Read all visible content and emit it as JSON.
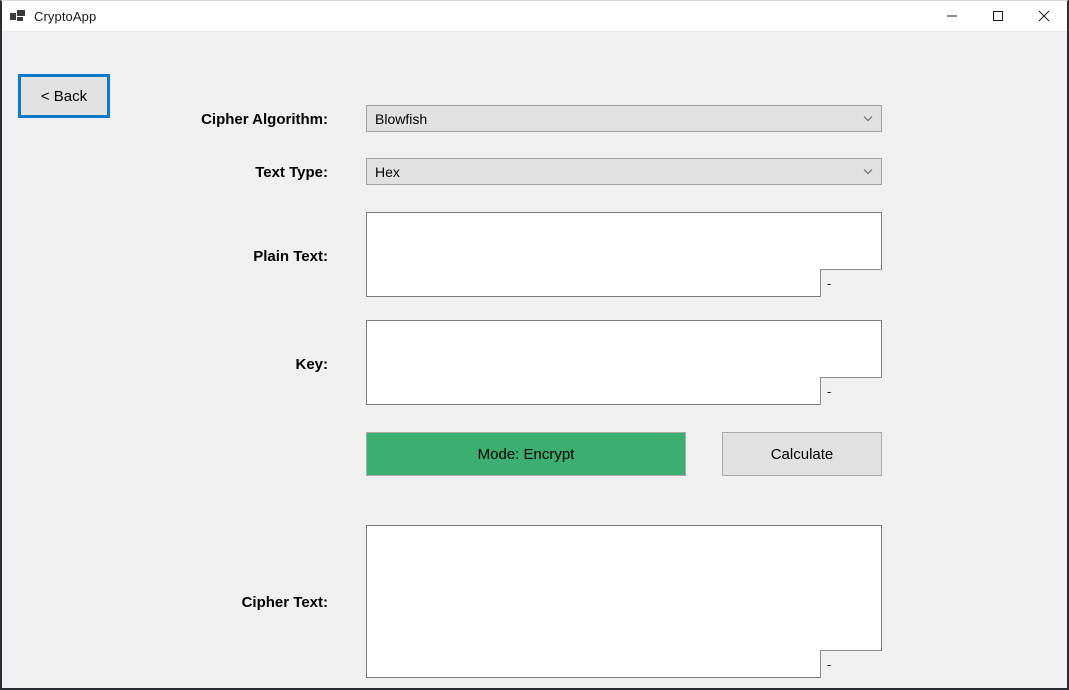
{
  "window": {
    "title": "CryptoApp",
    "icon": "app-window-icon",
    "controls": {
      "minimize": "minimize-icon",
      "maximize": "maximize-icon",
      "close": "close-icon"
    }
  },
  "colors": {
    "accent_focus": "#0a7bc8",
    "encrypt_green": "#3cae70",
    "client_bg": "#f0f0f0",
    "control_bg": "#e1e1e1",
    "field_bg": "#ffffff"
  },
  "nav": {
    "back_label": "< Back"
  },
  "form": {
    "cipher_algorithm": {
      "label": "Cipher Algorithm:",
      "value": "Blowfish",
      "chevron": "chevron-down-icon"
    },
    "text_type": {
      "label": "Text Type:",
      "value": "Hex",
      "chevron": "chevron-down-icon"
    },
    "plain_text": {
      "label": "Plain Text:",
      "value": "",
      "counter": "-"
    },
    "key": {
      "label": "Key:",
      "value": "",
      "counter": "-"
    },
    "cipher_text": {
      "label": "Cipher Text:",
      "value": "",
      "counter": "-"
    }
  },
  "actions": {
    "mode_label": "Mode: Encrypt",
    "calculate_label": "Calculate"
  }
}
